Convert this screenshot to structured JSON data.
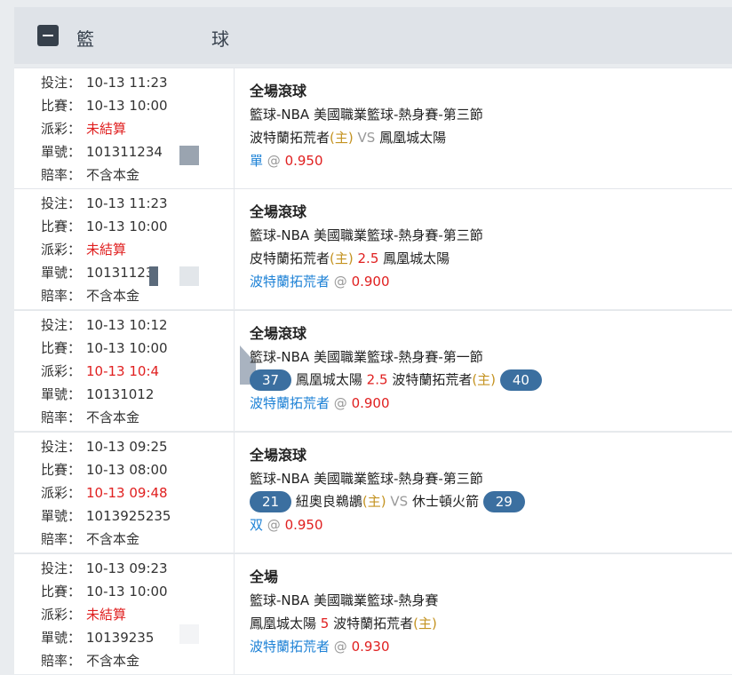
{
  "header": {
    "title_left": "籃",
    "title_right": "球"
  },
  "labels": {
    "bet": "投注：",
    "match": "比賽：",
    "payout": "派彩：",
    "ticket": "單號：",
    "odds": "賠率：",
    "at": "@"
  },
  "bets": [
    {
      "bet_time": "10-13 11:23",
      "match_time": "10-13 10:00",
      "payout": "未結算",
      "ticket": "101311234",
      "odds_type": "不含本金",
      "market": "全場滾球",
      "league": "籃球-NBA 美國職業籃球-熱身賽-第三節",
      "team_home": "波特蘭拓荒者",
      "home_tag": "(主)",
      "mid": "VS",
      "team_away": "鳳凰城太陽",
      "selection": "單",
      "price": "0.950"
    },
    {
      "bet_time": "10-13 11:23",
      "match_time": "10-13 10:00",
      "payout": "未結算",
      "ticket": "10131123",
      "odds_type": "不含本金",
      "market": "全場滾球",
      "league": "籃球-NBA 美國職業籃球-熱身賽-第三節",
      "team_home": "皮特蘭拓荒者",
      "home_tag": "(主)",
      "mid": "2.5",
      "team_away": "鳳凰城太陽",
      "selection": "波特蘭拓荒者",
      "price": "0.900"
    },
    {
      "bet_time": "10-13 10:12",
      "match_time": "10-13 10:00",
      "payout": "10-13 10:4",
      "ticket": "10131012",
      "odds_type": "不含本金",
      "market": "全場滾球",
      "league": "籃球-NBA 美國職業籃球-熱身賽-第一節",
      "score_left": "37",
      "team_left": "鳳凰城太陽",
      "mid": "2.5",
      "team_right": "波特蘭拓荒者",
      "right_tag": "(主)",
      "score_right": "40",
      "selection": "波特蘭拓荒者",
      "price": "0.900"
    },
    {
      "bet_time": "10-13 09:25",
      "match_time": "10-13 08:00",
      "payout": "10-13 09:48",
      "ticket": "1013925235",
      "odds_type": "不含本金",
      "market": "全場滾球",
      "league": "籃球-NBA 美國職業籃球-熱身賽-第三節",
      "score_left": "21",
      "team_left": "紐奧良鵜鶘",
      "left_tag": "(主)",
      "mid": "VS",
      "team_right": "休士頓火箭",
      "score_right": "29",
      "selection": "双",
      "price": "0.950"
    },
    {
      "bet_time": "10-13 09:23",
      "match_time": "10-13 10:00",
      "payout": "未結算",
      "ticket": "10139235",
      "odds_type": "不含本金",
      "market": "全場",
      "league": "籃球-NBA 美國職業籃球-熱身賽",
      "team_left": "鳳凰城太陽",
      "mid": "5",
      "team_right": "波特蘭拓荒者",
      "right_tag": "(主)",
      "selection": "波特蘭拓荒者",
      "price": "0.930"
    }
  ]
}
